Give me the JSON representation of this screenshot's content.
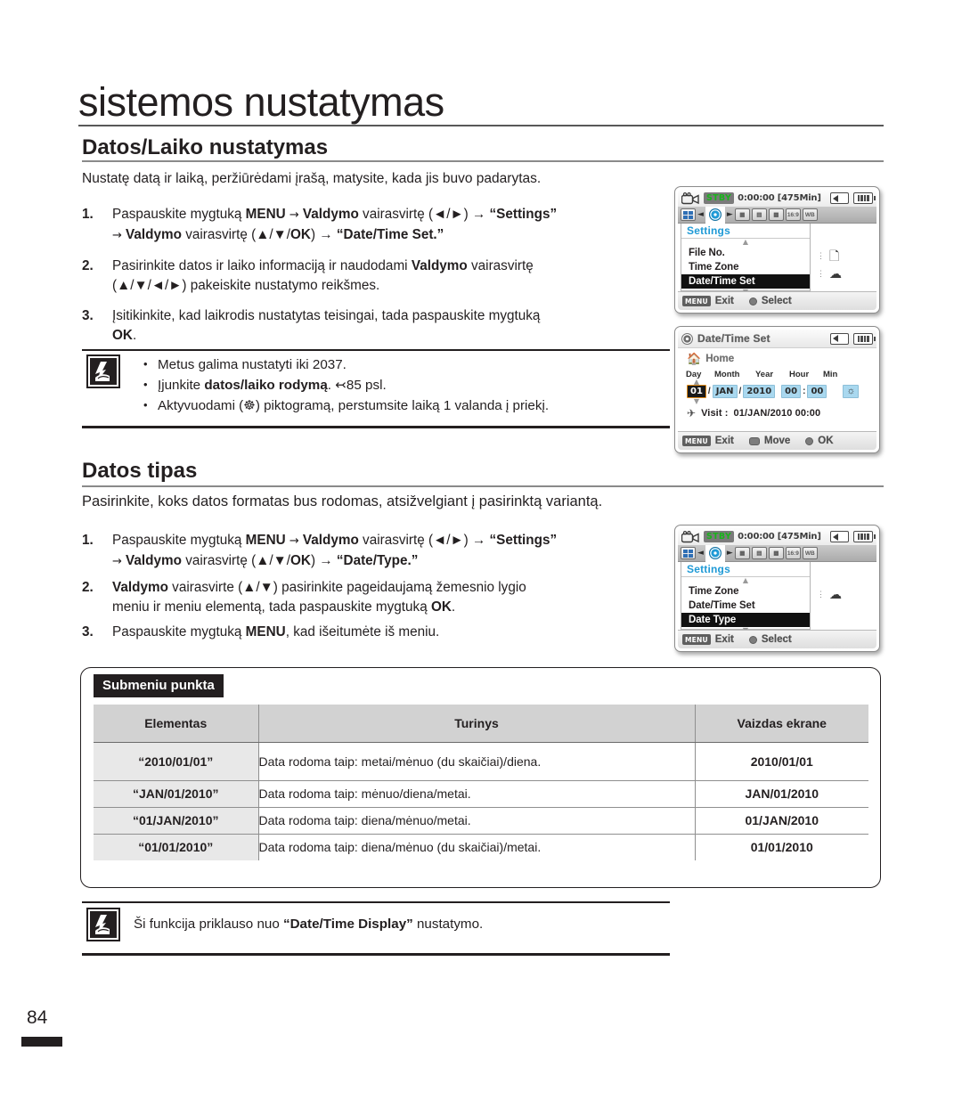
{
  "page": {
    "title": "sistemos nustatymas",
    "number": "84"
  },
  "section1": {
    "heading": "Datos/Laiko nustatymas",
    "intro": "Nustatę datą ir laiką, peržiūrėdami įrašą, matysite, kada jis buvo padarytas.",
    "steps": [
      {
        "num": "1.",
        "line1_a": "Paspauskite mygtuką ",
        "line1_b": "MENU",
        "line1_c": " → ",
        "line1_d": "Valdymo",
        "line1_e": " vairasvirtę (◄/►) → ",
        "line1_f": "“Settings”",
        "line2_a": "→ ",
        "line2_b": "Valdymo",
        "line2_c": " vairasvirtę (▲/▼/",
        "line2_d": "OK",
        "line2_e": ") → ",
        "line2_f": "“Date/Time Set.”"
      },
      {
        "num": "2.",
        "line1_a": " Pasirinkite datos ir laiko informaciją ir naudodami ",
        "line1_b": "Valdymo",
        "line1_c": " vairasvirtę",
        "line2_a": "(▲/▼/◄/►) pakeiskite nustatymo reikšmes."
      },
      {
        "num": "3.",
        "line1_a": "Įsitikinkite, kad laikrodis nustatytas teisingai, tada paspauskite mygtuką",
        "line2_b": "OK",
        "line2_c": "."
      }
    ],
    "note_items": [
      {
        "a": "Metus galima nustatyti iki 2037."
      },
      {
        "a": "Įjunkite ",
        "b": "datos/laiko rodymą",
        "c": ". ↢85 psl."
      },
      {
        "a": "Aktyvuodami (☸) piktogramą, perstumsite laiką 1 valanda į priekį."
      }
    ]
  },
  "section2": {
    "heading": "Datos tipas",
    "intro": "Pasirinkite, koks datos formatas bus rodomas, atsižvelgiant į pasirinktą variantą.",
    "steps": [
      {
        "num": "1.",
        "line1_a": "Paspauskite mygtuką ",
        "line1_b": "MENU",
        "line1_c": " → ",
        "line1_d": "Valdymo",
        "line1_e": " vairasvirtę (◄/►) → ",
        "line1_f": "“Settings”",
        "line2_a": "→ ",
        "line2_b": "Valdymo",
        "line2_c": " vairasvirtę (▲/▼/",
        "line2_d": "OK",
        "line2_e": ") → ",
        "line2_f": "“Date/Type.”"
      },
      {
        "num": "2.",
        "line1_b": "Valdymo",
        "line1_c": " vairasvirte (▲/▼) pasirinkite pageidaujamą žemesnio lygio",
        "line2_a": "meniu ir meniu elementą, tada paspauskite mygtuką ",
        "line2_b": "OK",
        "line2_c": "."
      },
      {
        "num": "3.",
        "line1_a": "Paspauskite mygtuką ",
        "line1_b": "MENU",
        "line1_c": ", kad išeitumėte iš meniu."
      }
    ]
  },
  "table": {
    "tag": "Submeniu punkta",
    "headers": [
      "Elementas",
      "Turinys",
      "Vaizdas ekrane"
    ],
    "rows": [
      {
        "item": "“2010/01/01”",
        "content": "Data rodoma taip: metai/mėnuo (du skaičiai)/diena.",
        "display": "2010/01/01"
      },
      {
        "item": "“JAN/01/2010”",
        "content": "Data rodoma taip: mėnuo/diena/metai.",
        "display": "JAN/01/2010"
      },
      {
        "item": "“01/JAN/2010”",
        "content": "Data rodoma taip: diena/mėnuo/metai.",
        "display": "01/JAN/2010"
      },
      {
        "item": "“01/01/2010”",
        "content": "Data rodoma taip: diena/mėnuo (du skaičiai)/metai.",
        "display": "01/01/2010"
      }
    ]
  },
  "bottom_note": {
    "a": "Ši funkcija priklauso nuo ",
    "b": "“Date/Time Display”",
    "c": " nustatymo."
  },
  "lcd1": {
    "status": {
      "stby": "STBY",
      "timecode": "0:00:00 [475Min]"
    },
    "menu_title": "Settings",
    "items": [
      "File No.",
      "Time Zone"
    ],
    "selected": "Date/Time Set",
    "footer": {
      "menu_key": "MENU",
      "exit": "Exit",
      "select": "Select"
    }
  },
  "lcd2": {
    "title": "Date/Time Set",
    "home": "Home",
    "col_headers": [
      "Day",
      "Month",
      "Year",
      "Hour",
      "Min"
    ],
    "fields": {
      "day": "01",
      "month": "JAN",
      "year": "2010",
      "hour": "00",
      "min": "00"
    },
    "visit_label": "Visit  :",
    "visit_value": "01/JAN/2010 00:00",
    "footer": {
      "menu_key": "MENU",
      "exit": "Exit",
      "move": "Move",
      "ok": "OK"
    }
  },
  "lcd3": {
    "status": {
      "stby": "STBY",
      "timecode": "0:00:00 [475Min]"
    },
    "menu_title": "Settings",
    "items": [
      "Time Zone",
      "Date/Time Set"
    ],
    "selected": "Date Type",
    "footer": {
      "menu_key": "MENU",
      "exit": "Exit",
      "select": "Select"
    }
  },
  "colors": {
    "accent_blue": "#1f9ad6",
    "stby_green": "#18b41a",
    "field_blue": "#a9d8ef",
    "highlight_orange": "#e08a18",
    "ink": "#231f20"
  }
}
